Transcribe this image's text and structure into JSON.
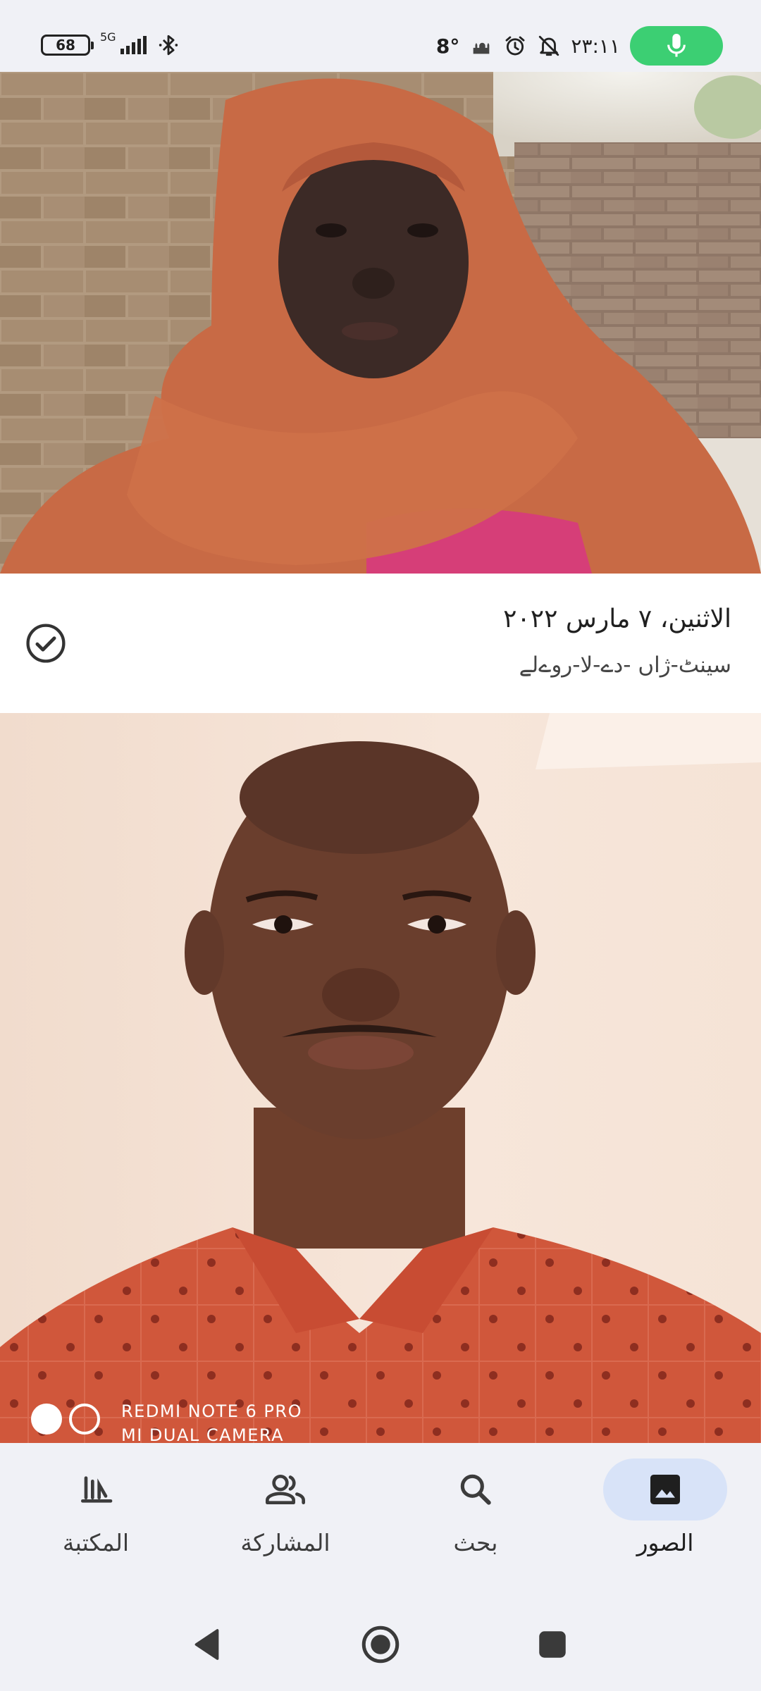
{
  "status_bar": {
    "battery": "68",
    "network": "5G",
    "temperature": "8°",
    "time": "٢٣:١١"
  },
  "section": {
    "date": "الاثنين، ٧ مارس ٢٠٢٢",
    "location": "سينٹ-ژاں -دے-لا-روےلے"
  },
  "watermark": {
    "line1": "REDMI NOTE 6 PRO",
    "line2": "MI DUAL CAMERA"
  },
  "bottom_nav": {
    "items": [
      {
        "label": "المكتبة",
        "icon": "library-icon"
      },
      {
        "label": "المشاركة",
        "icon": "people-icon"
      },
      {
        "label": "بحث",
        "icon": "search-icon"
      },
      {
        "label": "الصور",
        "icon": "photo-icon",
        "active": true
      }
    ]
  },
  "colors": {
    "accent_green": "#3ccf73",
    "active_pill": "#d8e3f8",
    "background": "#f0f1f6"
  }
}
